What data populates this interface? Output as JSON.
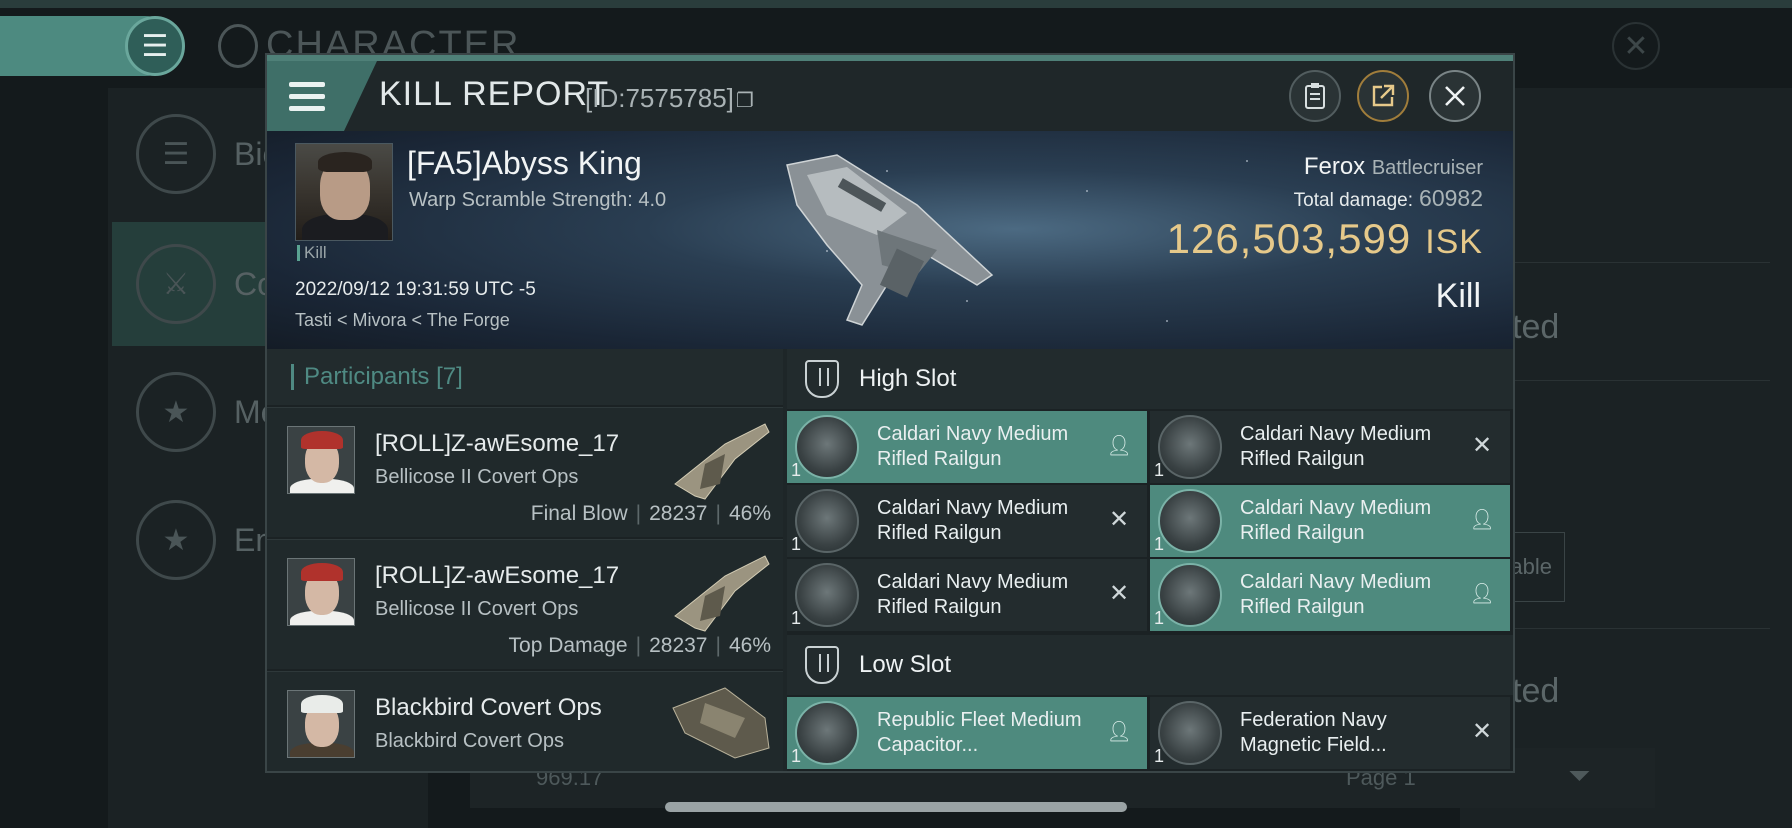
{
  "background": {
    "title": "CHARACTER",
    "menu_icon": "hamburger-icon",
    "left_items": [
      {
        "label": "Bio",
        "icon": "hamburger-icon"
      },
      {
        "label": "Co",
        "icon": "crossed-swords-icon"
      },
      {
        "label": "Me",
        "icon": "star-icon"
      },
      {
        "label": "Em",
        "icon": "star-icon"
      }
    ],
    "right_texts": [
      "ted",
      "able",
      "ted"
    ],
    "bottom_value": "969.17",
    "bottom_page": "Page 1",
    "filter_icon": "filter-icon"
  },
  "modal": {
    "title": "KILL REPORT",
    "id_text": "[ID:7575785]",
    "buttons": [
      "clipboard-icon",
      "share-icon",
      "close-icon"
    ]
  },
  "victim": {
    "name": "[FA5]Abyss King",
    "subtitle": "Warp Scramble Strength: 4.0",
    "tag": "Kill",
    "datetime": "2022/09/12 19:31:59 UTC -5",
    "location": "Tasti < Mivora < The Forge",
    "ship": "Ferox",
    "ship_class": "Battlecruiser",
    "total_damage_label": "Total damage:",
    "total_damage": "60982",
    "isk_value": "126,503,599",
    "isk_unit": "ISK",
    "result": "Kill"
  },
  "participants": {
    "title": "Participants",
    "count": "[7]",
    "rows": [
      {
        "name": "[ROLL]Z-awEsome_17",
        "ship": "Bellicose II Covert Ops",
        "tag": "Final Blow",
        "damage": "28237",
        "percent": "46%"
      },
      {
        "name": "[ROLL]Z-awEsome_17",
        "ship": "Bellicose II Covert Ops",
        "tag": "Top Damage",
        "damage": "28237",
        "percent": "46%"
      },
      {
        "name": "Blackbird Covert Ops",
        "ship": "Blackbird Covert Ops",
        "tag": "",
        "damage": "",
        "percent": ""
      }
    ]
  },
  "slots": {
    "high_title": "High Slot",
    "low_title": "Low Slot",
    "high": [
      {
        "qty": "1",
        "name": "Caldari Navy Medium Rifled Railgun",
        "state": "dropped"
      },
      {
        "qty": "1",
        "name": "Caldari Navy Medium Rifled Railgun",
        "state": "destroyed"
      },
      {
        "qty": "1",
        "name": "Caldari Navy Medium Rifled Railgun",
        "state": "destroyed"
      },
      {
        "qty": "1",
        "name": "Caldari Navy Medium Rifled Railgun",
        "state": "dropped"
      },
      {
        "qty": "1",
        "name": "Caldari Navy Medium Rifled Railgun",
        "state": "destroyed"
      },
      {
        "qty": "1",
        "name": "Caldari Navy Medium Rifled Railgun",
        "state": "dropped"
      }
    ],
    "low": [
      {
        "qty": "1",
        "name": "Republic Fleet Medium Capacitor...",
        "state": "dropped"
      },
      {
        "qty": "1",
        "name": "Federation Navy Magnetic Field...",
        "state": "destroyed"
      }
    ],
    "dropped_icon": "person-icon",
    "destroyed_icon": "x-icon"
  }
}
